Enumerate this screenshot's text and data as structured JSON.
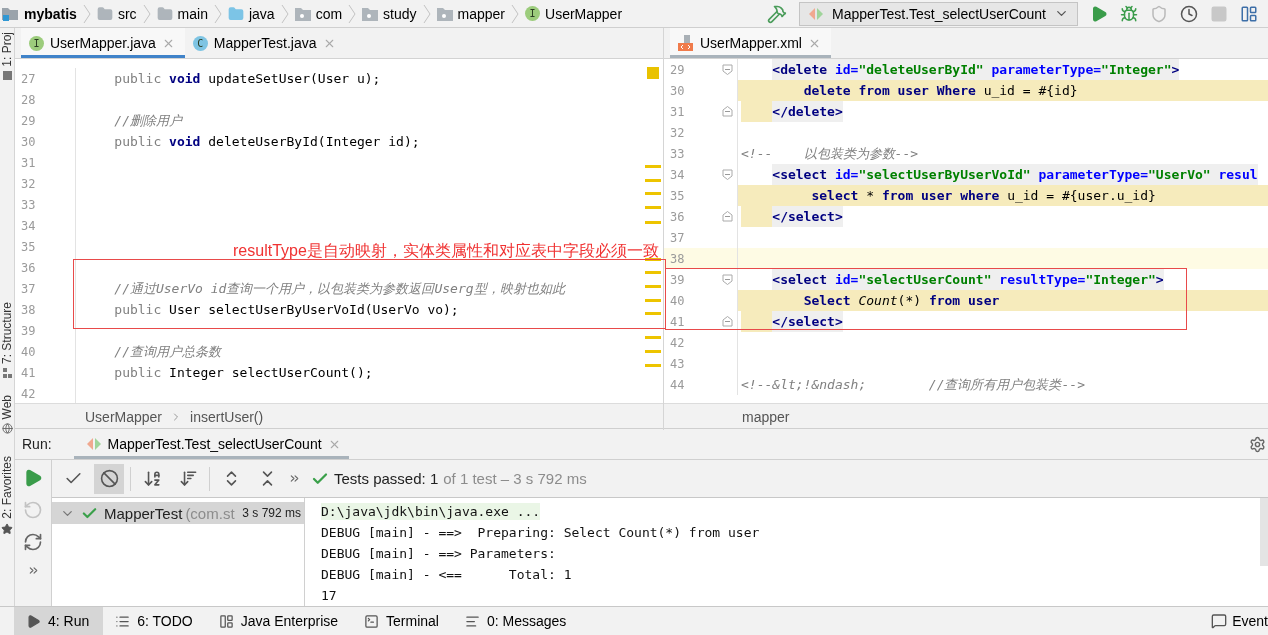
{
  "nav_bar": {
    "breadcrumbs": [
      {
        "label": "mybatis",
        "kind": "project"
      },
      {
        "label": "src",
        "kind": "folder"
      },
      {
        "label": "main",
        "kind": "folder"
      },
      {
        "label": "java",
        "kind": "source"
      },
      {
        "label": "com",
        "kind": "package"
      },
      {
        "label": "study",
        "kind": "package"
      },
      {
        "label": "mapper",
        "kind": "package"
      },
      {
        "label": "UserMapper",
        "kind": "interface",
        "badge": "I"
      }
    ],
    "run_config": "MapperTest.Test_selectUserCount",
    "actions": [
      {
        "kind": "run",
        "disabled": false
      },
      {
        "kind": "debug",
        "disabled": false
      },
      {
        "kind": "coverage",
        "disabled": true
      },
      {
        "kind": "profile",
        "disabled": false
      },
      {
        "kind": "stop",
        "disabled": true
      },
      {
        "kind": "structure",
        "disabled": false
      }
    ]
  },
  "side_tools": [
    {
      "label": "1: Proj",
      "kind": "project"
    },
    {
      "label": "7: Structure",
      "kind": "structure"
    },
    {
      "label": "Web",
      "kind": "web"
    },
    {
      "label": "2: Favorites",
      "kind": "favorites"
    }
  ],
  "editors": [
    {
      "focused": true,
      "tabs": [
        {
          "label": "UserMapper.java",
          "kind": "interface",
          "badge": "I",
          "selected": true
        },
        {
          "label": "MapperTest.java",
          "kind": "class",
          "badge": "C",
          "selected": false
        }
      ],
      "lines": [
        {
          "number": "27",
          "kind": "plain",
          "tokens": [
            {
              "text": "    public ",
              "kind": "muted"
            },
            {
              "text": "void",
              "kind": "keyword"
            },
            {
              "text": " updateSetUser(User u);",
              "kind": "plain"
            }
          ]
        },
        {
          "number": "28",
          "kind": "empty"
        },
        {
          "number": "29",
          "kind": "plain",
          "tokens": [
            {
              "text": "    //删除用户",
              "kind": "comment"
            }
          ]
        },
        {
          "number": "30",
          "kind": "plain",
          "tokens": [
            {
              "text": "    public ",
              "kind": "muted"
            },
            {
              "text": "void",
              "kind": "keyword"
            },
            {
              "text": " deleteUserById(Integer id);",
              "kind": "plain"
            }
          ]
        },
        {
          "number": "31",
          "kind": "empty"
        },
        {
          "number": "32",
          "kind": "empty"
        },
        {
          "number": "33",
          "kind": "empty"
        },
        {
          "number": "34",
          "kind": "empty"
        },
        {
          "number": "35",
          "kind": "empty"
        },
        {
          "number": "36",
          "kind": "empty"
        },
        {
          "number": "37",
          "kind": "plain",
          "tokens": [
            {
              "text": "    //通过UserVo id查询一个用户，以包装类为参数返回Userg型，映射也如此",
              "kind": "comment"
            }
          ]
        },
        {
          "number": "38",
          "kind": "plain",
          "tokens": [
            {
              "text": "    public ",
              "kind": "muted"
            },
            {
              "text": "User selectUserByUserVoId(UserVo vo);",
              "kind": "plain"
            }
          ]
        },
        {
          "number": "39",
          "kind": "empty"
        },
        {
          "number": "40",
          "kind": "plain",
          "tokens": [
            {
              "text": "    //查询用户总条数",
              "kind": "comment"
            }
          ]
        },
        {
          "number": "41",
          "kind": "plain",
          "tokens": [
            {
              "text": "    public ",
              "kind": "muted"
            },
            {
              "text": "Integer selectUserCount();",
              "kind": "plain"
            }
          ]
        },
        {
          "number": "42",
          "kind": "empty"
        }
      ],
      "breadcrumbs": [
        "UserMapper",
        "insertUser()"
      ]
    },
    {
      "focused": false,
      "tabs": [
        {
          "label": "UserMapper.xml",
          "kind": "xml",
          "selected": true
        }
      ],
      "lines": [
        {
          "number": "29",
          "kind": "tag",
          "current": false,
          "tokens": [
            {
              "text": "    <delete",
              "kind": "tag"
            },
            {
              "text": " id=",
              "kind": "attr"
            },
            {
              "text": "\"deleteUserById\"",
              "kind": "string"
            },
            {
              "text": " parameterType=",
              "kind": "attr"
            },
            {
              "text": "\"Integer\"",
              "kind": "string"
            },
            {
              "text": ">",
              "kind": "tag"
            }
          ]
        },
        {
          "number": "30",
          "kind": "block",
          "current": false,
          "tokens": [
            {
              "text": "        delete from user Where",
              "kind": "keyword"
            },
            {
              "text": " u_id = #{id}",
              "kind": "plain"
            }
          ]
        },
        {
          "number": "31",
          "kind": "close",
          "current": false,
          "tokens": [
            {
              "text": "    </delete>",
              "kind": "tag"
            }
          ]
        },
        {
          "number": "32",
          "kind": "empty",
          "current": false
        },
        {
          "number": "33",
          "kind": "plain",
          "current": false,
          "tokens": [
            {
              "text": "<!--    以包装类为参数-->",
              "kind": "comment"
            }
          ]
        },
        {
          "number": "34",
          "kind": "tag",
          "current": false,
          "tokens": [
            {
              "text": "    <select",
              "kind": "tag"
            },
            {
              "text": " id=",
              "kind": "attr"
            },
            {
              "text": "\"selectUserByUserVoId\"",
              "kind": "string"
            },
            {
              "text": " parameterType=",
              "kind": "attr"
            },
            {
              "text": "\"UserVo\"",
              "kind": "string"
            },
            {
              "text": " resul",
              "kind": "attr"
            }
          ]
        },
        {
          "number": "35",
          "kind": "block",
          "current": false,
          "tokens": [
            {
              "text": "         select",
              "kind": "keyword"
            },
            {
              "text": " * ",
              "kind": "plain"
            },
            {
              "text": "from user where",
              "kind": "keyword"
            },
            {
              "text": " u_id = #{user.u_id}",
              "kind": "plain"
            }
          ]
        },
        {
          "number": "36",
          "kind": "close",
          "current": false,
          "tokens": [
            {
              "text": "    </select>",
              "kind": "tag"
            }
          ]
        },
        {
          "number": "37",
          "kind": "empty",
          "current": false
        },
        {
          "number": "38",
          "kind": "empty",
          "current": true
        },
        {
          "number": "39",
          "kind": "tag",
          "current": false,
          "tokens": [
            {
              "text": "    <select",
              "kind": "tag"
            },
            {
              "text": " id=",
              "kind": "attr"
            },
            {
              "text": "\"selectUserCount\"",
              "kind": "string"
            },
            {
              "text": " resultType=",
              "kind": "attr"
            },
            {
              "text": "\"Integer\"",
              "kind": "string"
            },
            {
              "text": ">",
              "kind": "tag"
            }
          ]
        },
        {
          "number": "40",
          "kind": "block",
          "current": false,
          "tokens": [
            {
              "text": "        Select ",
              "kind": "keyword"
            },
            {
              "text": "Count",
              "kind": "italic"
            },
            {
              "text": "(*) ",
              "kind": "plain"
            },
            {
              "text": "from user",
              "kind": "keyword"
            }
          ]
        },
        {
          "number": "41",
          "kind": "close",
          "current": false,
          "tokens": [
            {
              "text": "    </select>",
              "kind": "tag"
            }
          ]
        },
        {
          "number": "42",
          "kind": "empty",
          "current": false
        },
        {
          "number": "43",
          "kind": "empty",
          "current": false
        },
        {
          "number": "44",
          "kind": "plain",
          "current": false,
          "tokens": [
            {
              "text": "<!--&lt;!&ndash;        //查询所有用户包装类-->",
              "kind": "comment"
            }
          ]
        }
      ],
      "breadcrumbs": [
        "mapper"
      ]
    }
  ],
  "annotation": {
    "text": "resultType是自动映射，实体类属性和对应表中字段必须一致"
  },
  "run_window": {
    "label": "Run:",
    "tabs": [
      {
        "label": "MapperTest.Test_selectUserCount",
        "selected": true
      }
    ],
    "side_actions": [
      {
        "kind": "rerun",
        "disabled": false
      },
      {
        "kind": "rerun-failed",
        "disabled": true
      },
      {
        "kind": "auto-test",
        "disabled": false
      }
    ],
    "toolbar": [
      {
        "kind": "show-passed",
        "selected": false
      },
      {
        "kind": "show-ignored",
        "selected": true
      },
      {
        "kind": "sort-alpha",
        "selected": false
      },
      {
        "kind": "sort-duration",
        "selected": false
      },
      {
        "kind": "expand",
        "selected": false
      },
      {
        "kind": "collapse",
        "selected": false
      }
    ],
    "status": {
      "passed": "Tests passed: 1",
      "detail": "of 1 test – 3 s 792 ms"
    },
    "tree": [
      {
        "name": "MapperTest",
        "package": "(com.st",
        "time": "3 s 792 ms",
        "passed": true,
        "expanded": true,
        "selected": true
      }
    ],
    "console": [
      {
        "text": "D:\\java\\jdk\\bin\\java.exe ...",
        "kind": "command"
      },
      {
        "text": "DEBUG [main] - ==>  Preparing: Select Count(*) from user",
        "kind": "output"
      },
      {
        "text": "DEBUG [main] - ==> Parameters:",
        "kind": "output"
      },
      {
        "text": "DEBUG [main] - <==      Total: 1",
        "kind": "output"
      },
      {
        "text": "17",
        "kind": "output"
      }
    ]
  },
  "bottom_bar": {
    "tools": [
      {
        "label": "4: Run",
        "kind": "run",
        "selected": true
      },
      {
        "label": "6: TODO",
        "kind": "todo",
        "selected": false
      },
      {
        "label": "Java Enterprise",
        "kind": "enterprise",
        "selected": false
      },
      {
        "label": "Terminal",
        "kind": "terminal",
        "selected": false
      },
      {
        "label": "0: Messages",
        "kind": "messages",
        "selected": false
      }
    ],
    "event": "Event"
  }
}
